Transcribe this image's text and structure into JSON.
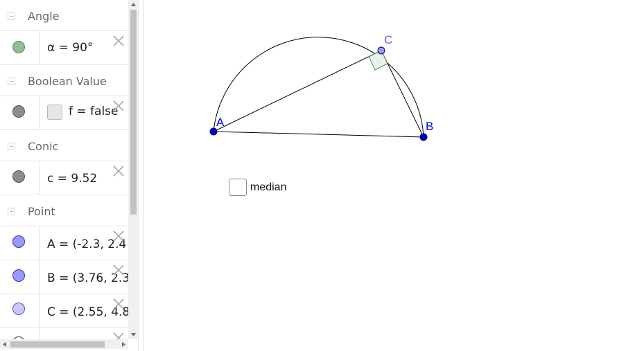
{
  "algebra": {
    "groups": [
      {
        "title": "Angle",
        "items": [
          {
            "text": "α = 90°",
            "color": "#8fc08f"
          }
        ]
      },
      {
        "title": "Boolean Value",
        "items": [
          {
            "text": "f = false",
            "color": "#8c8c8c"
          }
        ]
      },
      {
        "title": "Conic",
        "items": [
          {
            "text": "c = 9.52",
            "color": "#8c8c8c"
          }
        ]
      },
      {
        "title": "Point",
        "items": [
          {
            "text": "A = (-2.3, 2.4",
            "color": "#9999ff"
          },
          {
            "text": "B = (3.76, 2.3",
            "color": "#9999ff"
          },
          {
            "text": "C = (2.55, 4.8",
            "color": "#c8c8ff"
          }
        ]
      }
    ]
  },
  "graphics": {
    "point_labels": {
      "A": "A",
      "B": "B",
      "C": "C"
    },
    "checkbox_label": "median",
    "colors": {
      "point_fill": "#0000cc",
      "point_c_fill": "#9a9aff",
      "label_blue": "#0000ff",
      "label_c": "#6666ff",
      "right_angle_fill": "#e8f2e8",
      "right_angle_stroke": "#5c8a5c",
      "line": "#000000"
    }
  }
}
